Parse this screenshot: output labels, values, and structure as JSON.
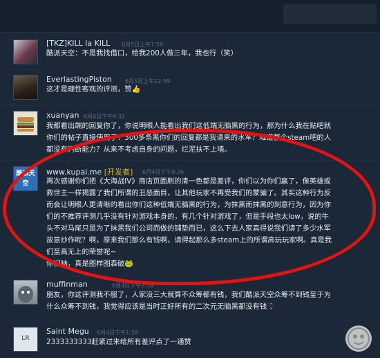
{
  "comments": [
    {
      "name": "[TKZ]KILL la KILL",
      "date": "6月5日上午7:59",
      "text": "酷派天空：不是我找借口，给我200人做三年，我也行（笑）"
    },
    {
      "name": "EverlastingPiston",
      "date": "6月5日上午12:59",
      "text": "这才是理性客观的评测，赞👍"
    },
    {
      "name": "xuanyan",
      "date": "6月4日下午9:32",
      "text": "我都看出端的回复你了，你说明眼人能看出我们这低端无脑黑的行为，那为什么我在贴吧就\n你们的帖子直接使用了？300多条黑你们的回复都是我请来的水军？难道整个steam吧的人\n都没有判断能力？从来不考虑自身的问题，烂泥扶不上墙。"
    },
    {
      "name": "www.kupai.me",
      "tag": "[开发者]",
      "date": "6月4日下午9:26",
      "avatar_label": "酷派天空",
      "text": "再次感谢你们把《大海战IV》商店页面刷的清一色都是差评，你们以为你们赢了，像英雄或\n救世主一样揭露了我们所谓的丑恶面目，让其他玩家不再受我们的蒙骗了。其实这种行为反\n而会让明眼人更清晰的看出你们这种低端无脑黑的行为，为抹黑而抹黑的刻意行为，因为你\n们的不推荐评测几乎没有针对游戏本身的，有几个针对游戏了，但是手段也太low，说的牛\n头不对马尾只是为了抹黑我们公司而做的铺垫而已，这么下去人家真得说我们请了多少水军\n故意炒作呢？啊，原来我们那么有钱啊，请得起那么多steam上的所谓高玩玩家啊。真是我\n们至高无上的荣誉呢~\n你们呐，真是图样图森破🐸"
    },
    {
      "name": "muffinman",
      "date": "6月4日下午2:18",
      "text": "朋友，你这评测我不服了，人家没三大就算不众筹都有钱，我们酷派天空众筹不到钱至于为\n什么众筹不到钱，我觉得应该是当时正好所有的二次元无脑黑都没有钱🦹"
    },
    {
      "name": "Saint Megu",
      "date": "6月4日下午1:59",
      "text": "2333333333赶紧过来给所有差评点了一通赞"
    }
  ],
  "colors": {
    "background": "#1b2838",
    "highlight_oval": "#e31313",
    "developer_tag": "#d0b23b"
  }
}
